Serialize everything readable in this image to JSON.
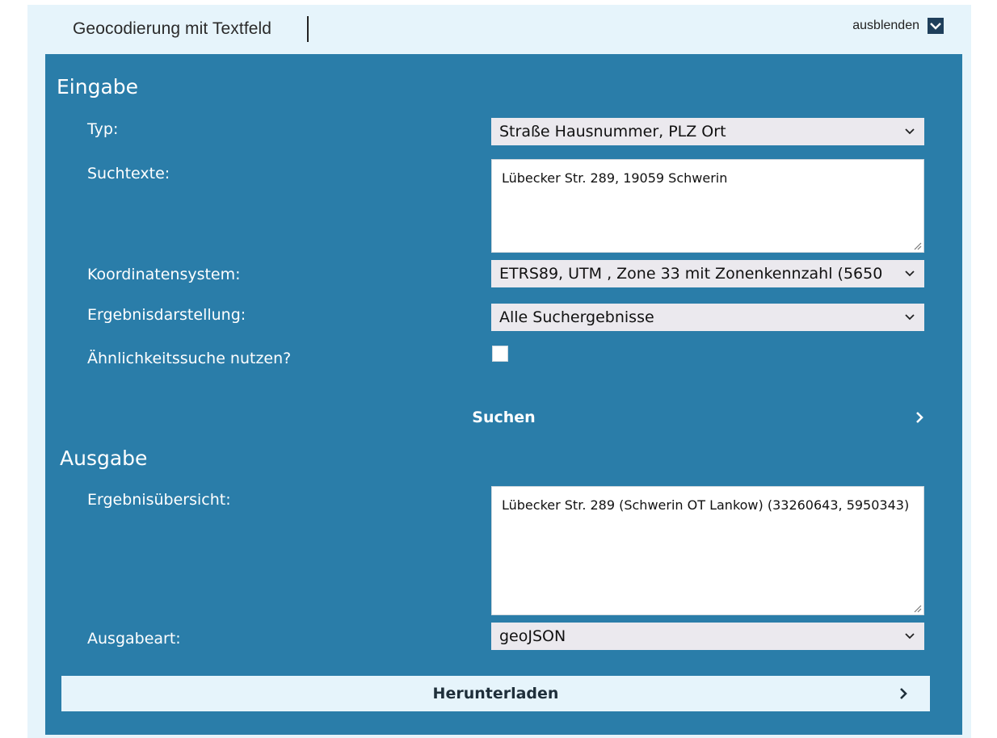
{
  "header": {
    "title": "Geocodierung mit Textfeld",
    "toggle_label": "ausblenden"
  },
  "input_section": {
    "heading": "Eingabe",
    "typ": {
      "label": "Typ:",
      "value": "Straße Hausnummer, PLZ Ort"
    },
    "suchtexte": {
      "label": "Suchtexte:",
      "value": "Lübecker Str. 289, 19059 Schwerin"
    },
    "koordinatensystem": {
      "label": "Koordinatensystem:",
      "value": "ETRS89, UTM , Zone 33 mit Zonenkennzahl (5650"
    },
    "ergebnisdarstellung": {
      "label": "Ergebnisdarstellung:",
      "value": "Alle Suchergebnisse"
    },
    "aehnlichkeit": {
      "label": "Ähnlichkeitssuche nutzen?",
      "checked": false
    },
    "search_button": "Suchen"
  },
  "output_section": {
    "heading": "Ausgabe",
    "ergebnisuebersicht": {
      "label": "Ergebnisübersicht:",
      "value": "Lübecker Str. 289 (Schwerin OT Lankow) (33260643, 5950343)"
    },
    "ausgabeart": {
      "label": "Ausgabeart:",
      "value": "geoJSON"
    },
    "download_button": "Herunterladen"
  },
  "colors": {
    "panel": "#2a7da9",
    "outer": "#e6f4fb",
    "select_bg": "#ebe9ee",
    "toggle_box": "#1f3f5b"
  },
  "icons": [
    "chevron-down-icon",
    "chevron-right-icon",
    "resize-handle-icon"
  ]
}
